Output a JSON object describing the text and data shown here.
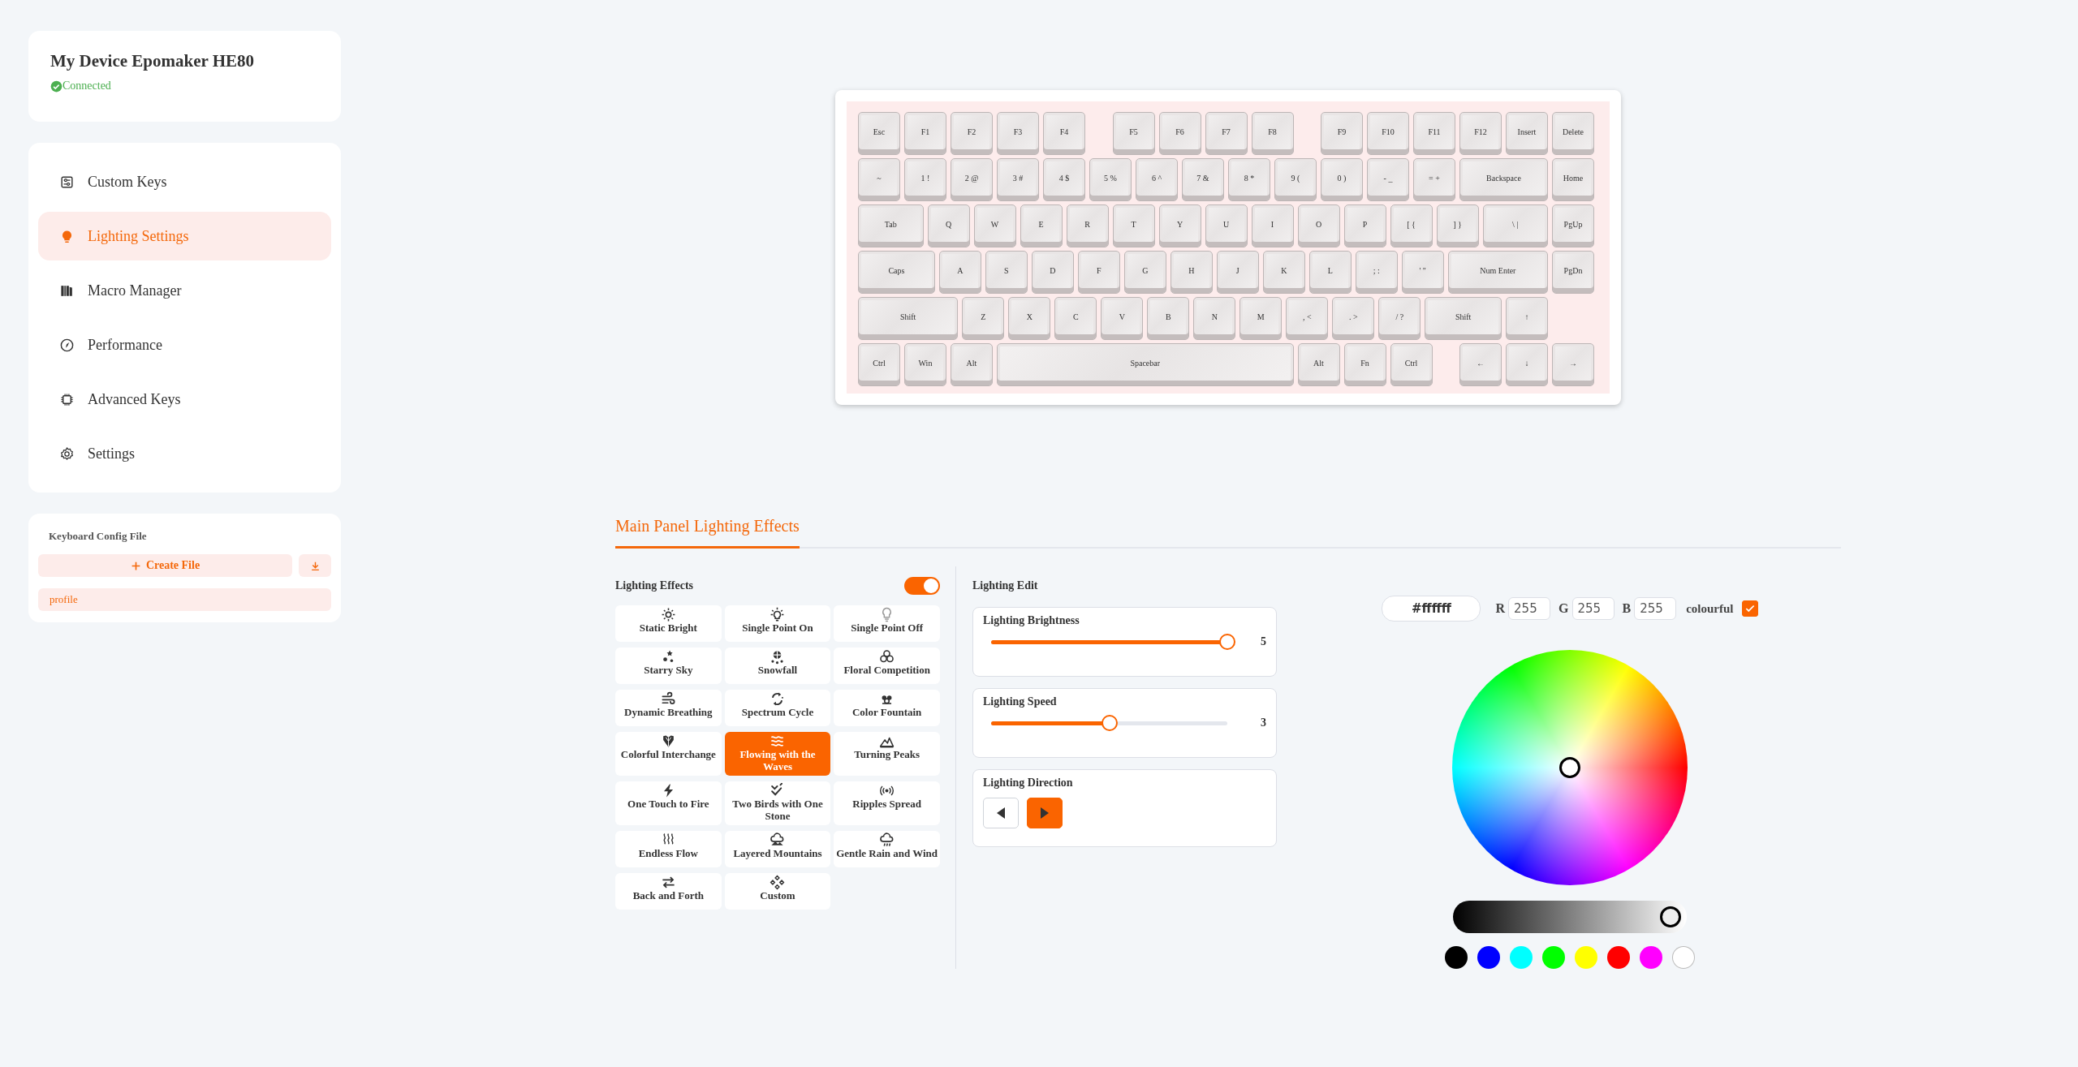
{
  "device": {
    "name": "My Device Epomaker HE80",
    "status": "Connected"
  },
  "nav": [
    {
      "label": "Custom Keys",
      "selected": false
    },
    {
      "label": "Lighting Settings",
      "selected": true
    },
    {
      "label": "Macro Manager",
      "selected": false
    },
    {
      "label": "Performance",
      "selected": false
    },
    {
      "label": "Advanced Keys",
      "selected": false
    },
    {
      "label": "Settings",
      "selected": false
    }
  ],
  "config_file": {
    "title": "Keyboard Config File",
    "create_button": "Create File",
    "files": [
      "profile"
    ]
  },
  "keyboard": {
    "rows": [
      {
        "keys": [
          "Esc",
          "F1",
          "F2",
          "F3",
          "F4",
          "F5",
          "F6",
          "F7",
          "F8",
          "F9",
          "F10",
          "F11",
          "F12",
          "Insert",
          "Delete"
        ]
      },
      {
        "keys": [
          "~",
          "1 !",
          "2 @",
          "3 #",
          "4 $",
          "5 %",
          "6 ^",
          "7 &",
          "8 *",
          "9 (",
          "0 )",
          "- _",
          "= +",
          "Backspace",
          "Home"
        ]
      },
      {
        "keys": [
          "Tab",
          "Q",
          "W",
          "E",
          "R",
          "T",
          "Y",
          "U",
          "I",
          "O",
          "P",
          "[ {",
          "] }",
          "\\ |",
          "PgUp"
        ]
      },
      {
        "keys": [
          "Caps",
          "A",
          "S",
          "D",
          "F",
          "G",
          "H",
          "J",
          "K",
          "L",
          "; :",
          "' \"",
          "Num Enter",
          "PgDn"
        ]
      },
      {
        "keys": [
          "Shift",
          "Z",
          "X",
          "C",
          "V",
          "B",
          "N",
          "M",
          ", <",
          ". >",
          "/ ?",
          "Shift",
          "↑"
        ]
      },
      {
        "keys": [
          "Ctrl",
          "Win",
          "Alt",
          "Spacebar",
          "Alt",
          "Fn",
          "Ctrl",
          "←",
          "↓",
          "→"
        ]
      }
    ]
  },
  "tabs": [
    {
      "label": "Main Panel Lighting Effects",
      "selected": true
    }
  ],
  "lighting_effects": {
    "title": "Lighting Effects",
    "on": true,
    "effects": [
      {
        "label": "Static Bright",
        "selected": false
      },
      {
        "label": "Single Point On",
        "selected": false
      },
      {
        "label": "Single Point Off",
        "selected": false
      },
      {
        "label": "Starry Sky",
        "selected": false
      },
      {
        "label": "Snowfall",
        "selected": false
      },
      {
        "label": "Floral Competition",
        "selected": false
      },
      {
        "label": "Dynamic Breathing",
        "selected": false
      },
      {
        "label": "Spectrum Cycle",
        "selected": false
      },
      {
        "label": "Color Fountain",
        "selected": false
      },
      {
        "label": "Colorful Interchange",
        "selected": false
      },
      {
        "label": "Flowing with the Waves",
        "selected": true
      },
      {
        "label": "Turning Peaks",
        "selected": false
      },
      {
        "label": "One Touch to Fire",
        "selected": false
      },
      {
        "label": "Two Birds with One Stone",
        "selected": false
      },
      {
        "label": "Ripples Spread",
        "selected": false
      },
      {
        "label": "Endless Flow",
        "selected": false
      },
      {
        "label": "Layered Mountains",
        "selected": false
      },
      {
        "label": "Gentle Rain and Wind",
        "selected": false
      },
      {
        "label": "Back and Forth",
        "selected": false
      },
      {
        "label": "Custom",
        "selected": false
      }
    ]
  },
  "lighting_edit": {
    "title": "Lighting Edit",
    "sliders": [
      {
        "label": "Lighting Brightness",
        "level": 1,
        "reading": "5"
      },
      {
        "label": "Lighting Speed",
        "level": 0.5,
        "reading": "3"
      }
    ],
    "direction": {
      "label": "Lighting Direction",
      "options": [
        {
          "kind": "left",
          "selected": false
        },
        {
          "kind": "right",
          "selected": true
        }
      ]
    }
  },
  "color_picker": {
    "hex": "#ffffff",
    "channels": [
      {
        "label": "R",
        "value": "255"
      },
      {
        "label": "G",
        "value": "255"
      },
      {
        "label": "B",
        "value": "255"
      }
    ],
    "colourful": {
      "label": "colourful",
      "checked": true
    },
    "value_bar": {
      "level": 1
    },
    "swatches": [
      {
        "color": "#000000"
      },
      {
        "color": "#0000ff"
      },
      {
        "color": "#00ffff"
      },
      {
        "color": "#00ff00"
      },
      {
        "color": "#ffff00"
      },
      {
        "color": "#ff0000"
      },
      {
        "color": "#ff00ff"
      },
      {
        "color": "#ffffff"
      }
    ]
  }
}
